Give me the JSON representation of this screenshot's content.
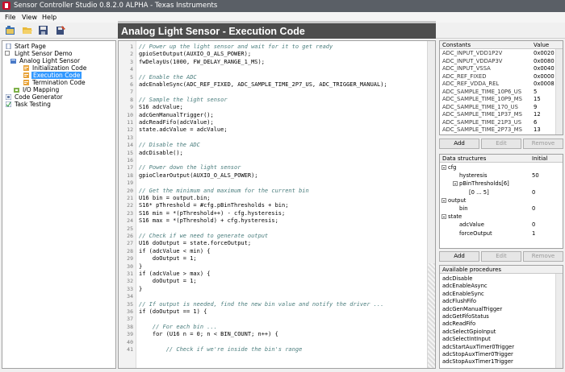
{
  "window": {
    "title": "Sensor Controller Studio 0.8.2.0 ALPHA - Texas Instruments"
  },
  "menu": [
    {
      "label": "File"
    },
    {
      "label": "View"
    },
    {
      "label": "Help"
    }
  ],
  "toolbar": {
    "buttons": [
      "new-project-icon",
      "open-folder-icon",
      "save-icon",
      "save-as-icon"
    ]
  },
  "tree": {
    "items": [
      {
        "label": "Start Page"
      },
      {
        "label": "Light Sensor Demo"
      },
      {
        "label": "Analog Light Sensor"
      },
      {
        "label": "Initialization Code"
      },
      {
        "label": "Execution Code"
      },
      {
        "label": "Termination Code"
      },
      {
        "label": "I/O Mapping"
      },
      {
        "label": "Code Generator"
      },
      {
        "label": "Task Testing"
      }
    ]
  },
  "page": {
    "title": "Analog Light Sensor - Execution Code"
  },
  "editor": {
    "lines": [
      {
        "n": "1",
        "text": "// Power up the light sensor and wait for it to get ready"
      },
      {
        "n": "2",
        "text": "gpioSetOutput(AUXIO_O_ALS_POWER);"
      },
      {
        "n": "3",
        "text": "fwDelayUs(1000, FW_DELAY_RANGE_1_MS);"
      },
      {
        "n": "4",
        "text": ""
      },
      {
        "n": "5",
        "text": "// Enable the ADC"
      },
      {
        "n": "6",
        "text": "adcEnableSync(ADC_REF_FIXED, ADC_SAMPLE_TIME_2P7_US, ADC_TRIGGER_MANUAL);"
      },
      {
        "n": "7",
        "text": ""
      },
      {
        "n": "8",
        "text": "// Sample the light sensor"
      },
      {
        "n": "9",
        "text": "S16 adcValue;"
      },
      {
        "n": "10",
        "text": "adcGenManualTrigger();"
      },
      {
        "n": "11",
        "text": "adcReadFifo(adcValue);"
      },
      {
        "n": "12",
        "text": "state.adcValue = adcValue;"
      },
      {
        "n": "13",
        "text": ""
      },
      {
        "n": "14",
        "text": "// Disable the ADC"
      },
      {
        "n": "15",
        "text": "adcDisable();"
      },
      {
        "n": "16",
        "text": ""
      },
      {
        "n": "17",
        "text": "// Power down the light sensor"
      },
      {
        "n": "18",
        "text": "gpioClearOutput(AUXIO_O_ALS_POWER);"
      },
      {
        "n": "19",
        "text": ""
      },
      {
        "n": "20",
        "text": "// Get the minimum and maximum for the current bin"
      },
      {
        "n": "21",
        "text": "U16 bin = output.bin;"
      },
      {
        "n": "22",
        "text": "S16* pThreshold = #cfg.pBinThresholds + bin;"
      },
      {
        "n": "23",
        "text": "S16 min = *(pThreshold++) - cfg.hysteresis;"
      },
      {
        "n": "24",
        "text": "S16 max = *(pThreshold) + cfg.hysteresis;"
      },
      {
        "n": "25",
        "text": ""
      },
      {
        "n": "26",
        "text": "// Check if we need to generate output"
      },
      {
        "n": "27",
        "text": "U16 doOutput = state.forceOutput;"
      },
      {
        "n": "28",
        "text": "if (adcValue < min) {"
      },
      {
        "n": "29",
        "text": "    doOutput = 1;"
      },
      {
        "n": "30",
        "text": "}"
      },
      {
        "n": "31",
        "text": "if (adcValue > max) {"
      },
      {
        "n": "32",
        "text": "    doOutput = 1;"
      },
      {
        "n": "33",
        "text": "}"
      },
      {
        "n": "34",
        "text": ""
      },
      {
        "n": "35",
        "text": "// If output is needed, find the new bin value and notify the driver ..."
      },
      {
        "n": "36",
        "text": "if (doOutput == 1) {"
      },
      {
        "n": "37",
        "text": ""
      },
      {
        "n": "38",
        "text": "    // For each bin ..."
      },
      {
        "n": "39",
        "text": "    for (U16 n = 0; n < BIN_COUNT; n++) {"
      },
      {
        "n": "40",
        "text": ""
      },
      {
        "n": "41",
        "text": "        // Check if we're inside the bin's range"
      }
    ]
  },
  "constants": {
    "header": {
      "name": "Constants",
      "value": "Value"
    },
    "rows": [
      {
        "name": "ADC_INPUT_VDD1P2V",
        "value": "0x0020"
      },
      {
        "name": "ADC_INPUT_VDDAP3V",
        "value": "0x0080"
      },
      {
        "name": "ADC_INPUT_VSSA",
        "value": "0x0040"
      },
      {
        "name": "ADC_REF_FIXED",
        "value": "0x0000"
      },
      {
        "name": "ADC_REF_VDDA_REL",
        "value": "0x0008"
      },
      {
        "name": "ADC_SAMPLE_TIME_10P6_US",
        "value": "5"
      },
      {
        "name": "ADC_SAMPLE_TIME_10P9_MS",
        "value": "15"
      },
      {
        "name": "ADC_SAMPLE_TIME_170_US",
        "value": "9"
      },
      {
        "name": "ADC_SAMPLE_TIME_1P37_MS",
        "value": "12"
      },
      {
        "name": "ADC_SAMPLE_TIME_21P3_US",
        "value": "6"
      },
      {
        "name": "ADC_SAMPLE_TIME_2P73_MS",
        "value": "13"
      }
    ],
    "buttons": {
      "add": "Add",
      "edit": "Edit",
      "remove": "Remove"
    }
  },
  "data_structures": {
    "header": {
      "name": "Data structures",
      "value": "Initial"
    },
    "rows": [
      {
        "name": "cfg",
        "value": ""
      },
      {
        "name": "hysteresis",
        "value": "50"
      },
      {
        "name": "pBinThresholds[6]",
        "value": ""
      },
      {
        "name": "[0 ... 5]",
        "value": "0"
      },
      {
        "name": "output",
        "value": ""
      },
      {
        "name": "bin",
        "value": "0"
      },
      {
        "name": "state",
        "value": ""
      },
      {
        "name": "adcValue",
        "value": "0"
      },
      {
        "name": "forceOutput",
        "value": "1"
      }
    ],
    "buttons": {
      "add": "Add",
      "edit": "Edit",
      "remove": "Remove"
    }
  },
  "procedures": {
    "header": "Available procedures",
    "items": [
      "adcDisable",
      "adcEnableAsync",
      "adcEnableSync",
      "adcFlushFifo",
      "adcGenManualTrigger",
      "adcGetFifoStatus",
      "adcReadFifo",
      "adcSelectGpioInput",
      "adcSelectIntInput",
      "adcStartAuxTimer0Trigger",
      "adcStopAuxTimer0Trigger",
      "adcStopAuxTimer1Trigger"
    ]
  }
}
